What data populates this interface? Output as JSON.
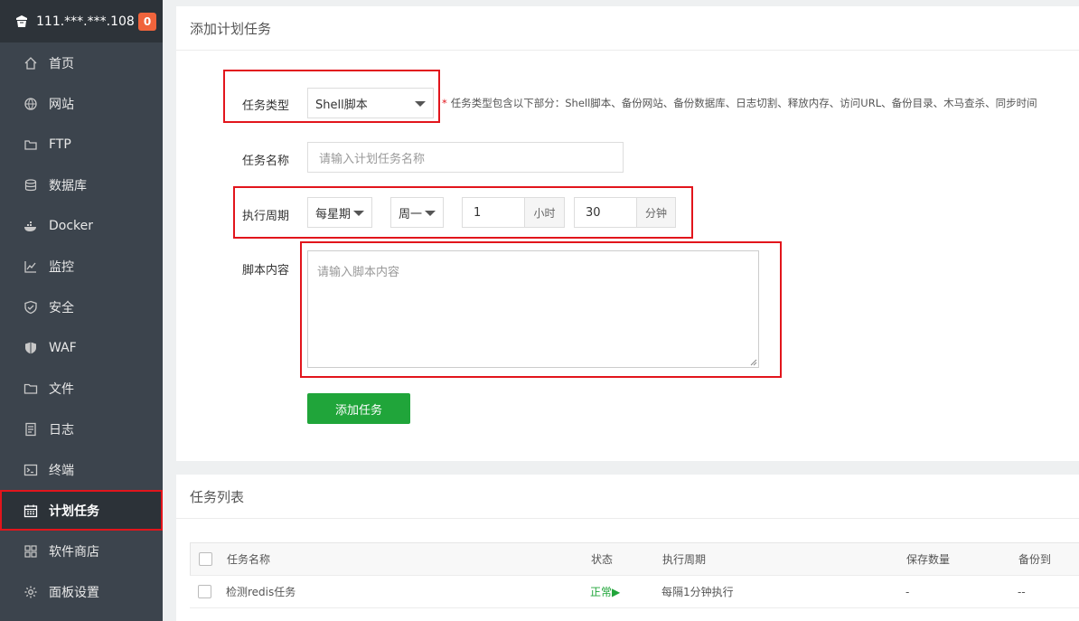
{
  "sidebar": {
    "server_ip": "111.***.***.108",
    "badge_count": "0",
    "items": [
      {
        "label": "首页",
        "icon": "home-icon"
      },
      {
        "label": "网站",
        "icon": "globe-icon"
      },
      {
        "label": "FTP",
        "icon": "ftp-icon"
      },
      {
        "label": "数据库",
        "icon": "database-icon"
      },
      {
        "label": "Docker",
        "icon": "docker-icon"
      },
      {
        "label": "监控",
        "icon": "monitor-icon"
      },
      {
        "label": "安全",
        "icon": "shield-icon"
      },
      {
        "label": "WAF",
        "icon": "waf-shield-icon"
      },
      {
        "label": "文件",
        "icon": "folder-icon"
      },
      {
        "label": "日志",
        "icon": "log-icon"
      },
      {
        "label": "终端",
        "icon": "terminal-icon"
      },
      {
        "label": "计划任务",
        "icon": "calendar-icon"
      },
      {
        "label": "软件商店",
        "icon": "grid-icon"
      },
      {
        "label": "面板设置",
        "icon": "gear-icon"
      }
    ],
    "active_index": 11
  },
  "add_task": {
    "title": "添加计划任务",
    "type_label": "任务类型",
    "type_value": "Shell脚本",
    "type_hint": "任务类型包含以下部分：Shell脚本、备份网站、备份数据库、日志切割、释放内存、访问URL、备份目录、木马查杀、同步时间",
    "name_label": "任务名称",
    "name_placeholder": "请输入计划任务名称",
    "cycle_label": "执行周期",
    "cycle_value": "每星期",
    "weekday_value": "周一",
    "hour_value": "1",
    "hour_unit": "小时",
    "minute_value": "30",
    "minute_unit": "分钟",
    "script_label": "脚本内容",
    "script_placeholder": "请输入脚本内容",
    "submit_label": "添加任务"
  },
  "task_list": {
    "title": "任务列表",
    "columns": [
      "任务名称",
      "状态",
      "执行周期",
      "保存数量",
      "备份到"
    ],
    "rows": [
      {
        "name": "检测redis任务",
        "status": "正常▶",
        "cycle": "每隔1分钟执行",
        "keep": "-",
        "backup": "--"
      }
    ]
  },
  "colors": {
    "accent_green": "#20a53a",
    "highlight_red": "#e2151c",
    "sidebar_bg": "#3c444d",
    "badge_orange": "#f0643c"
  }
}
